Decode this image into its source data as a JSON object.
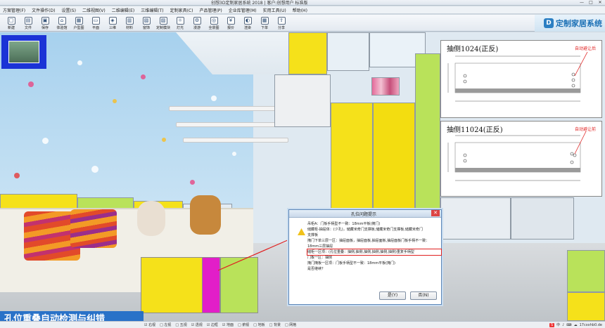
{
  "window": {
    "title": "创想3D定制家居系统 2018 | 客户:创想用户 标准版",
    "controls": [
      "—",
      "□",
      "✕"
    ]
  },
  "menu": [
    "方案管理(F)",
    "文件操作(D)",
    "设置(S)",
    "二维视图(V)",
    "二维编辑(E)",
    "三维编辑(T)",
    "定制家具(C)",
    "产品管理(P)",
    "企业库管理(M)",
    "实用工具(U)",
    "帮助(H)"
  ],
  "toolbar": [
    {
      "label": "新建",
      "icon": "new-file-icon",
      "glyph": "□"
    },
    {
      "label": "文件",
      "icon": "folder-icon",
      "glyph": "▤"
    },
    {
      "label": "保存",
      "icon": "save-icon",
      "glyph": "▣"
    },
    {
      "label": "体验馆",
      "icon": "showroom-icon",
      "glyph": "⌂"
    },
    {
      "label": "户型图",
      "icon": "floorplan-icon",
      "glyph": "▦"
    },
    {
      "label": "平面",
      "icon": "plan-icon",
      "glyph": "▭"
    },
    {
      "label": "三维",
      "icon": "cube-icon",
      "glyph": "◈"
    },
    {
      "label": "材料",
      "icon": "material-icon",
      "glyph": "▥"
    },
    {
      "label": "窗饰",
      "icon": "curtain-icon",
      "glyph": "▧"
    },
    {
      "label": "定制模块",
      "icon": "module-icon",
      "glyph": "▨"
    },
    {
      "label": "灯光",
      "icon": "light-icon",
      "glyph": "☼"
    },
    {
      "label": "漫游",
      "icon": "walk-icon",
      "glyph": "⚙"
    },
    {
      "label": "全景图",
      "icon": "panorama-icon",
      "glyph": "◎"
    },
    {
      "label": "报价",
      "icon": "quote-icon",
      "glyph": "¥"
    },
    {
      "label": "渲染",
      "icon": "render-icon",
      "glyph": "◐"
    },
    {
      "label": "下单",
      "icon": "order-icon",
      "glyph": "▦"
    },
    {
      "label": "分享",
      "icon": "share-icon",
      "glyph": "⇪"
    }
  ],
  "brand": {
    "logo": "D",
    "name": "定制家居系统"
  },
  "drawings": [
    {
      "title": "抽侧1024(正反)",
      "note": "自动避让后"
    },
    {
      "title": "抽侧11024(正反)",
      "note": "自动避让前"
    }
  ],
  "dialog": {
    "title": "孔位问题提示",
    "messages": [
      "吊柜A：门板手柄型不一致：18mm平板(掩门)",
      "储藏柜-抽屉体：(少孔)，储藏米奇门支撑板,储藏米奇门支撑板,储藏米奇门",
      "支撑板",
      "掩门下单三层一区：抽屉面板，抽屉面板,抽屉面板,抽屉面板门板手柄不一致：",
      "18mm三层抽屉",
      "储柜一区项：(孔位重叠：抽侧,抽侧,抽侧,抽侧,抽侧,抽侧)重复手柄型",
      "门板一区：抽侧",
      "掩门掩板一区项：门板手柄型不一致：18mm平板(掩门)",
      "是否继续？"
    ],
    "highlight_index": 5,
    "yes": "是(Y)",
    "no": "否(N)"
  },
  "caption": "孔位重叠自动检测与纠错",
  "statusbar": {
    "options": [
      "☑ 右视",
      "□ 左视",
      "□ 五视",
      "☑ 透视",
      "☑ 边框",
      "☑ 地面",
      "□ 俯视",
      "□ 地板",
      "□ 背景",
      "□ 网格"
    ],
    "tray": [
      "S",
      "中",
      "♪",
      "⌨",
      "☁",
      "17cxxhb0.de"
    ]
  },
  "colors": {
    "accent": "#1a6fb5",
    "caption_bg": "#1868c8",
    "cabinet_yellow": "#f5e11a",
    "cabinet_green": "#b9e25a",
    "cabinet_magenta": "#e21ec8",
    "highlight_red": "#e02020"
  }
}
